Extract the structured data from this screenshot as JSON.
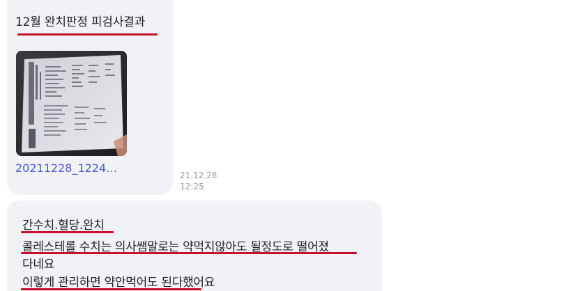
{
  "messages": [
    {
      "caption": "12월 완치판정 피검사결과",
      "attachment": {
        "filename": "20211228_1224…",
        "thumbnail_icon": "photo-of-lab-report"
      },
      "timestamp_date": "21.12.28",
      "timestamp_time": "12:25"
    },
    {
      "lines": [
        "간수치.혈당.완치",
        "콜레스테롤 수치는 의사쌤말로는 약먹지않아도 될정도로 떨어졌",
        "다네요",
        "이렇게 관리하면 약안먹어도 된다했어요"
      ]
    }
  ],
  "colors": {
    "bubble_bg": "#f1f2f6",
    "text": "#222222",
    "link": "#4a5bd0",
    "timestamp": "#9a9ba3",
    "annotation_underline": "#c8102e"
  }
}
